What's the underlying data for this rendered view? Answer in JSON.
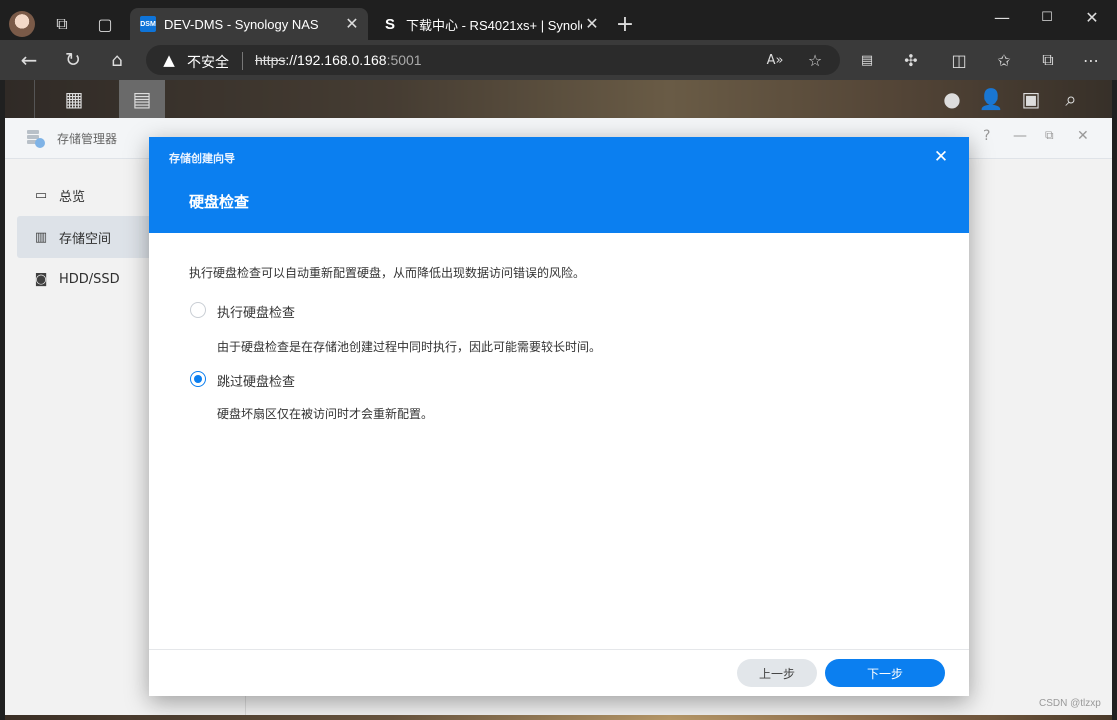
{
  "browser": {
    "tabs": [
      {
        "favicon": "dsm-favicon",
        "title": "DEV-DMS - Synology NAS",
        "active": true
      },
      {
        "favicon": "synology-s-favicon",
        "title": "下载中心 - RS4021xs+ | Synology",
        "active": false
      }
    ],
    "address": {
      "security_label": "不安全",
      "scheme": "https",
      "host_path": "://192.168.0.168",
      "port": ":5001"
    }
  },
  "storage_manager": {
    "title": "存储管理器",
    "sidebar": [
      {
        "label": "总览",
        "icon": "overview-icon",
        "active": false
      },
      {
        "label": "存储空间",
        "icon": "storage-icon",
        "active": true
      },
      {
        "label": "HDD/SSD",
        "icon": "disk-icon",
        "active": false
      }
    ]
  },
  "wizard": {
    "window_title": "存储创建向导",
    "step_title": "硬盘检查",
    "description": "执行硬盘检查可以自动重新配置硬盘，从而降低出现数据访问错误的风险。",
    "options": [
      {
        "label": "执行硬盘检查",
        "note": "由于硬盘检查是在存储池创建过程中同时执行，因此可能需要较长时间。",
        "selected": false
      },
      {
        "label": "跳过硬盘检查",
        "note": "硬盘坏扇区仅在被访问时才会重新配置。",
        "selected": true
      }
    ],
    "buttons": {
      "prev": "上一步",
      "next": "下一步"
    }
  },
  "watermark": "CSDN @tlzxp",
  "colors": {
    "accent": "#0b7ff0",
    "sidebar_active": "#e9eff5"
  }
}
